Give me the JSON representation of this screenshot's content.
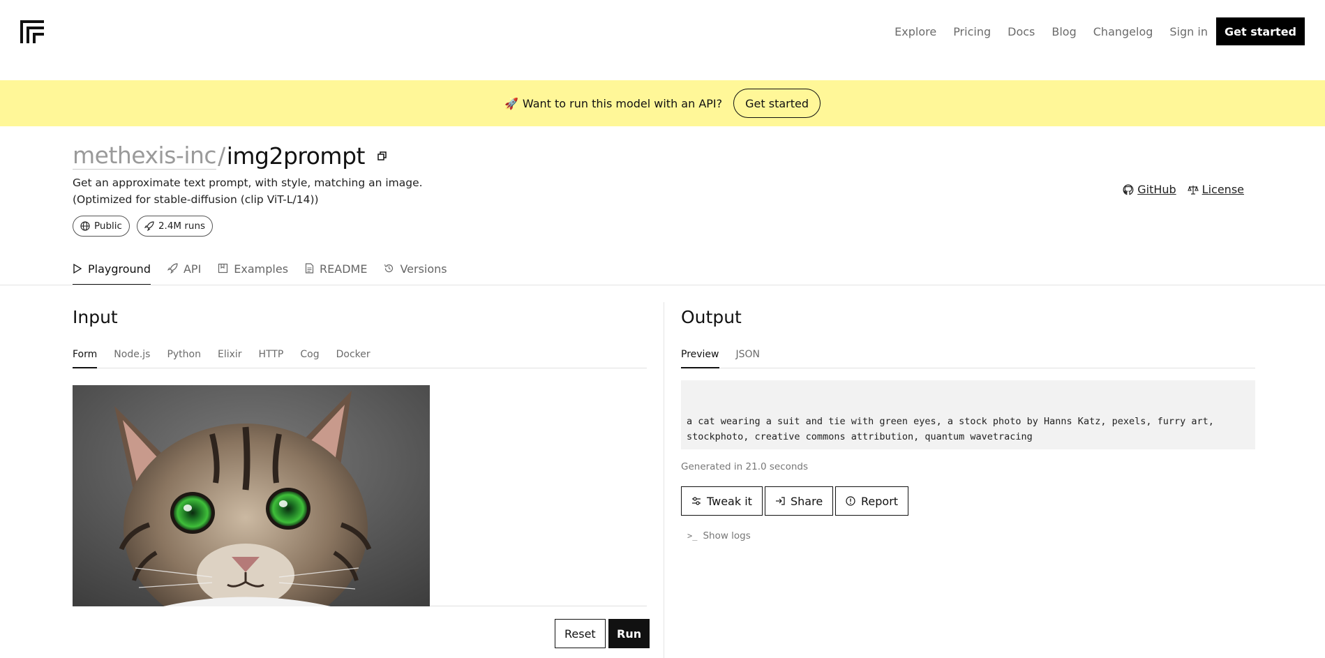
{
  "nav": {
    "links": [
      "Explore",
      "Pricing",
      "Docs",
      "Blog",
      "Changelog",
      "Sign in"
    ],
    "cta": "Get started"
  },
  "banner": {
    "text": "Want to run this model with an API?",
    "button": "Get started"
  },
  "model": {
    "owner": "methexis-inc",
    "separator": "/",
    "name": "img2prompt",
    "description": "Get an approximate text prompt, with style, matching an image. (Optimized for stable-diffusion (clip ViT-L/14))",
    "badges": {
      "visibility": "Public",
      "runs": "2.4M runs"
    },
    "links": {
      "github": "GitHub",
      "license": "License"
    }
  },
  "tabs": {
    "items": [
      "Playground",
      "API",
      "Examples",
      "README",
      "Versions"
    ],
    "active": "Playground"
  },
  "input": {
    "title": "Input",
    "tabs": [
      "Form",
      "Node.js",
      "Python",
      "Elixir",
      "HTTP",
      "Cog",
      "Docker"
    ],
    "active_tab": "Form",
    "reset_label": "Reset",
    "run_label": "Run"
  },
  "output": {
    "title": "Output",
    "tabs": [
      "Preview",
      "JSON"
    ],
    "active_tab": "Preview",
    "text": "a cat wearing a suit and tie with green eyes, a stock photo by Hanns Katz, pexels, furry art, stockphoto, creative commons attribution, quantum wavetracing",
    "generated": "Generated in 21.0 seconds",
    "actions": {
      "tweak": "Tweak it",
      "share": "Share",
      "report": "Report"
    },
    "show_logs": "Show logs"
  },
  "colors": {
    "banner": "#fff798",
    "primary": "#000000",
    "muted": "#6b6b6b",
    "output_bg": "#f2f2f2"
  }
}
